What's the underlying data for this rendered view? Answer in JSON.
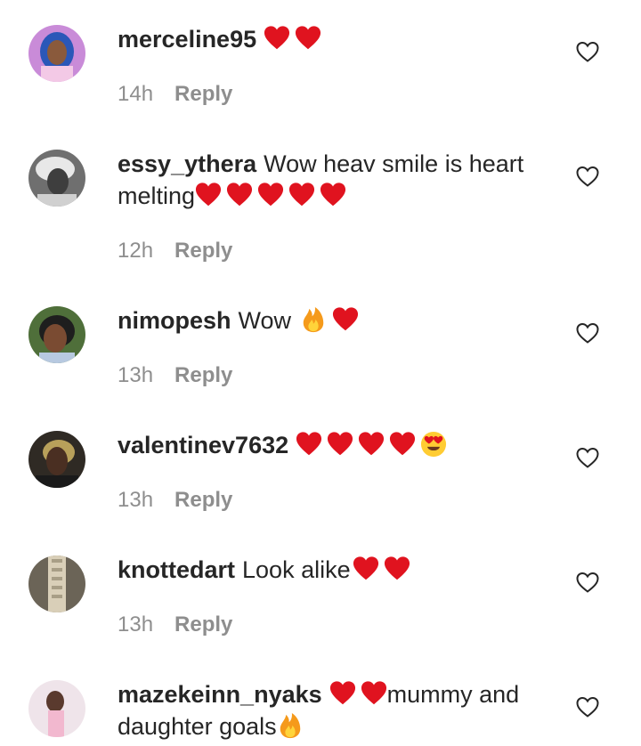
{
  "colors": {
    "text": "#262626",
    "secondary": "#8e8e8e",
    "heart": "#e0131f",
    "fire": "#f59a1b"
  },
  "comments": [
    {
      "username": "merceline95",
      "text_before": "",
      "emojis": [
        "red-heart",
        "red-heart"
      ],
      "text_after": "",
      "time": "14h",
      "reply_label": "Reply",
      "avatar": "profile-photo-purple"
    },
    {
      "username": "essy_ythera",
      "text_before": "Wow heav smile is heart melting",
      "emojis": [
        "red-heart",
        "red-heart",
        "red-heart",
        "red-heart",
        "red-heart"
      ],
      "text_after": "",
      "time": "12h",
      "reply_label": "Reply",
      "avatar": "profile-photo-bw"
    },
    {
      "username": "nimopesh",
      "text_before": "Wow",
      "emojis": [
        "fire",
        "red-heart"
      ],
      "text_after": "",
      "time": "13h",
      "reply_label": "Reply",
      "avatar": "profile-photo-smile"
    },
    {
      "username": "valentinev7632",
      "text_before": "",
      "emojis": [
        "red-heart",
        "red-heart",
        "red-heart",
        "red-heart",
        "heart-eyes"
      ],
      "text_after": "",
      "time": "13h",
      "reply_label": "Reply",
      "avatar": "profile-photo-dark"
    },
    {
      "username": "knottedart",
      "text_before": "Look alike",
      "emojis": [
        "red-heart",
        "red-heart"
      ],
      "text_after": "",
      "time": "13h",
      "reply_label": "Reply",
      "avatar": "profile-photo-macrame"
    },
    {
      "username": "mazekeinn_nyaks",
      "text_before": "",
      "emojis": [
        "red-heart",
        "red-heart"
      ],
      "text_after": "mummy and daughter goals",
      "trailing_emojis": [
        "fire"
      ],
      "time": "",
      "reply_label": "",
      "avatar": "profile-photo-pink"
    }
  ]
}
